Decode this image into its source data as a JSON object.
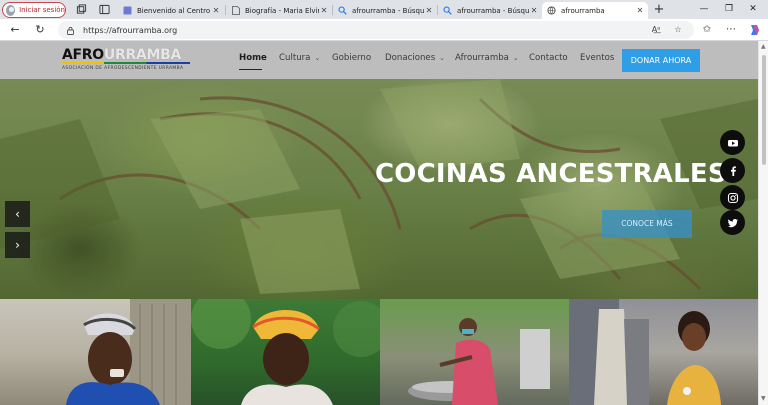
{
  "browser": {
    "profile_label": "Iniciar sesión",
    "tabs": [
      {
        "title": "Bienvenido al Centro E",
        "icon": "page-icon"
      },
      {
        "title": "Biografía - Maria Elvira",
        "icon": "document-icon"
      },
      {
        "title": "afrourramba - Búsqued",
        "icon": "search-icon"
      },
      {
        "title": "afrourramba - Búsqued",
        "icon": "search-icon"
      },
      {
        "title": "afrourramba",
        "icon": "site-icon",
        "active": true
      }
    ],
    "url": "https://afrourramba.org"
  },
  "site": {
    "logo": {
      "part1": "AFRO",
      "part2": "URRAMBA",
      "subtitle": "ASOCIACIÓN DE AFRODESCENDIENTE URRAMBA"
    },
    "menu": [
      {
        "label": "Home",
        "has_dropdown": false,
        "active": true
      },
      {
        "label": "Cultura",
        "has_dropdown": true
      },
      {
        "label": "Gobierno",
        "has_dropdown": false
      },
      {
        "label": "Donaciones",
        "has_dropdown": true
      },
      {
        "label": "Afrourramba",
        "has_dropdown": true
      },
      {
        "label": "Contacto",
        "has_dropdown": false
      },
      {
        "label": "Eventos",
        "has_dropdown": false
      }
    ],
    "donate_label": "DONAR AHORA",
    "hero": {
      "title": "COCINAS ANCESTRALES",
      "cta": "CONOCE MÁS"
    },
    "social": [
      "youtube-icon",
      "facebook-icon",
      "instagram-icon",
      "twitter-icon"
    ],
    "colors": {
      "accent": "#2f9ee6",
      "header_bg": "#bdbdbd"
    }
  }
}
